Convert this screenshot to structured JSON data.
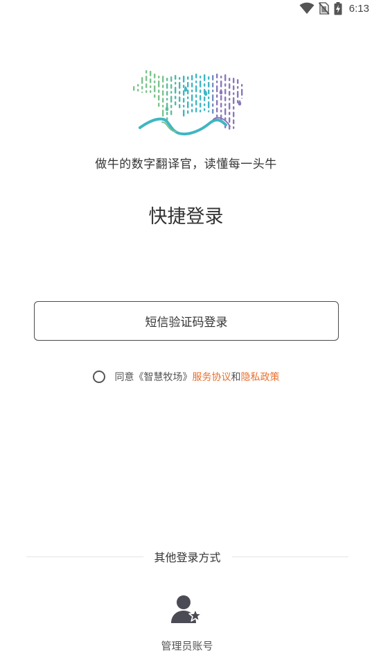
{
  "status_bar": {
    "time": "6:13",
    "icons": [
      "wifi-icon",
      "no-sim-icon",
      "battery-charging-icon"
    ]
  },
  "branding": {
    "logo": "cow-data-logo",
    "slogan": "做牛的数字翻译官，读懂每一头牛"
  },
  "page": {
    "title": "快捷登录"
  },
  "login": {
    "sms_button_label": "短信验证码登录"
  },
  "agreement": {
    "prefix": "同意《智慧牧场》",
    "service_link": "服务协议",
    "conjunction": "和",
    "privacy_link": "隐私政策",
    "checked": false
  },
  "other_login": {
    "divider_label": "其他登录方式",
    "admin_label": "管理员账号",
    "admin_icon": "admin-user-icon"
  },
  "colors": {
    "link": "#e8702f",
    "logo_green": "#7cc38c",
    "logo_teal": "#3fb6c2",
    "logo_purple": "#8a78b8",
    "icon_dark": "#4b4b55"
  }
}
